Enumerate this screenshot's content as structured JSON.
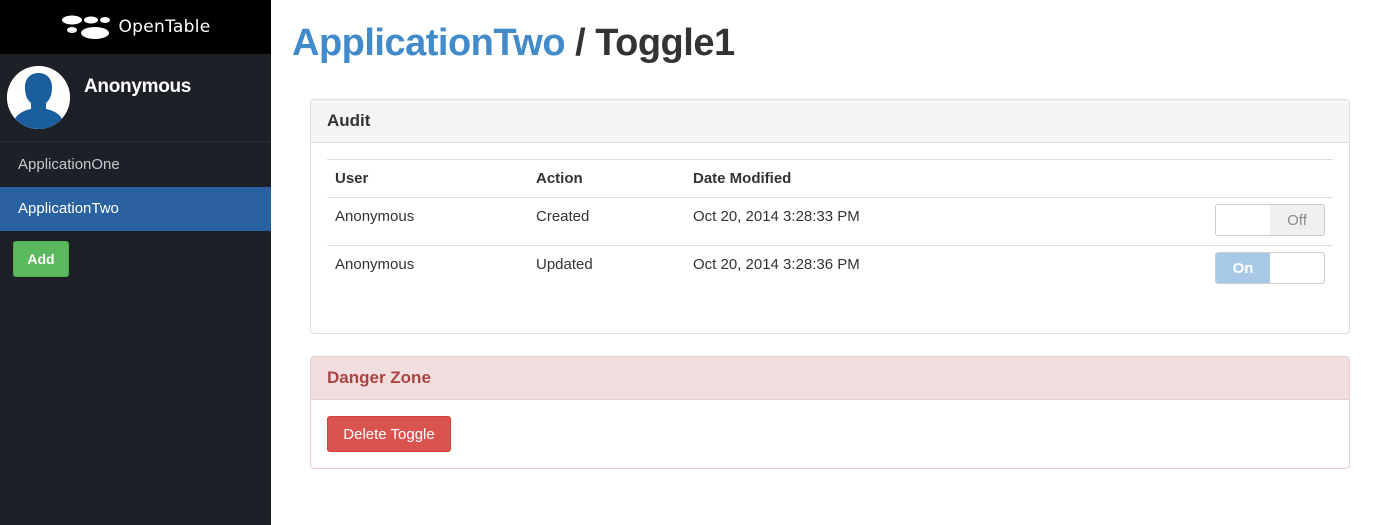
{
  "brand": {
    "name": "OpenTable",
    "logo_icon": "opentable-logo-icon"
  },
  "user": {
    "name": "Anonymous",
    "avatar_icon": "user-silhouette-icon"
  },
  "sidebar": {
    "items": [
      {
        "label": "ApplicationOne",
        "active": false
      },
      {
        "label": "ApplicationTwo",
        "active": true
      }
    ],
    "add_label": "Add"
  },
  "header": {
    "app": "ApplicationTwo",
    "separator": " / ",
    "toggle": "Toggle1"
  },
  "audit": {
    "title": "Audit",
    "columns": [
      "User",
      "Action",
      "Date Modified"
    ],
    "rows": [
      {
        "user": "Anonymous",
        "action": "Created",
        "date": "Oct 20, 2014 3:28:33 PM",
        "toggle_label": "Off"
      },
      {
        "user": "Anonymous",
        "action": "Updated",
        "date": "Oct 20, 2014 3:28:36 PM",
        "toggle_label": "On"
      }
    ]
  },
  "danger": {
    "title": "Danger Zone",
    "delete_label": "Delete Toggle"
  },
  "colors": {
    "sidebar_bg": "#1e2027",
    "nav_active": "#2a62a1",
    "link": "#428bca",
    "add_button": "#5cb85c",
    "danger_button": "#d9534f",
    "danger_heading_bg": "#f2dede",
    "danger_text": "#a94442"
  }
}
